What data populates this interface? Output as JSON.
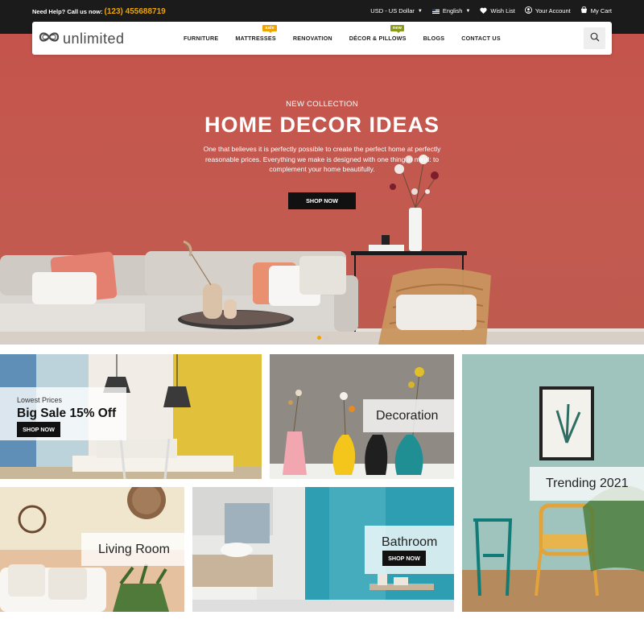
{
  "topbar": {
    "help_label": "Need Help? Call us now:",
    "phone": "(123) 455688719",
    "currency": "USD - US Dollar",
    "language": "English",
    "wishlist": "Wish List",
    "account": "Your Account",
    "cart": "My Cart"
  },
  "header": {
    "logo": "unlimited",
    "nav": [
      {
        "label": "FURNITURE"
      },
      {
        "label": "MATTRESSES",
        "badge": "sale"
      },
      {
        "label": "RENOVATION"
      },
      {
        "label": "DÉCOR & PILLOWS",
        "badge": "new"
      },
      {
        "label": "BLOGS"
      },
      {
        "label": "CONTACT US"
      }
    ]
  },
  "hero": {
    "subtitle": "NEW COLLECTION",
    "title": "HOME DECOR IDEAS",
    "description": "One that believes it is perfectly possible to create the perfect home at perfectly reasonable prices. Everything we make is designed with one thing in mind: to complement your home beautifully.",
    "button": "SHOP NOW",
    "slides": 2,
    "active_slide": 1
  },
  "banners": {
    "sale": {
      "small": "Lowest Prices",
      "big": "Big Sale 15% Off",
      "button": "SHOP NOW"
    },
    "decoration": {
      "title": "Decoration"
    },
    "trending": {
      "title": "Trending 2021"
    },
    "living": {
      "title": "Living Room"
    },
    "bathroom": {
      "title": "Bathroom",
      "button": "SHOP NOW"
    }
  },
  "colors": {
    "accent": "#f0a400",
    "topbar": "#1b1b1b",
    "hero_wall": "#c4544c",
    "badge_new": "#8a9a1a"
  },
  "icons": [
    "heart-icon",
    "user-icon",
    "cart-icon",
    "search-icon",
    "chevron-down-icon",
    "flag-icon"
  ]
}
